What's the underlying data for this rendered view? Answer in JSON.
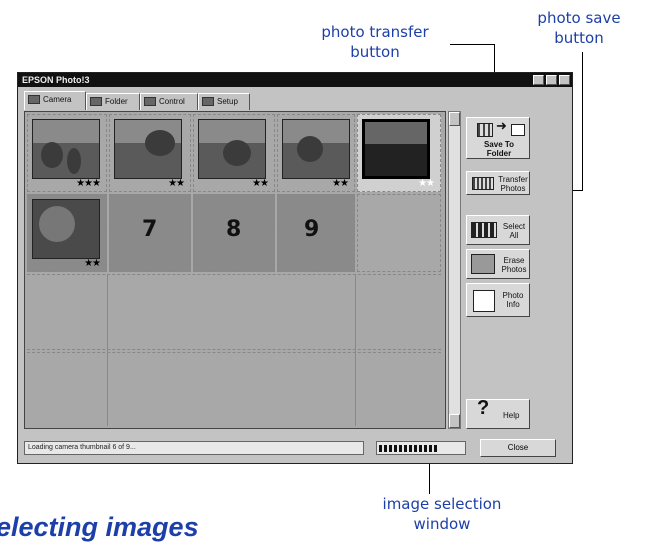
{
  "callouts": {
    "transfer": [
      "photo transfer",
      "button"
    ],
    "save": [
      "photo save",
      "button"
    ],
    "selection": [
      "image selection",
      "window"
    ]
  },
  "window": {
    "title": "EPSON Photo!3",
    "tabs": [
      "Camera",
      "Folder",
      "Control",
      "Setup"
    ]
  },
  "grid": {
    "thumbnails": [
      {
        "stars": "★★★"
      },
      {
        "stars": "★★"
      },
      {
        "stars": "★★"
      },
      {
        "stars": "★★"
      },
      {
        "stars": "★★",
        "selected": true
      },
      {
        "stars": "★★"
      }
    ],
    "placeholders": [
      "7",
      "8",
      "9"
    ]
  },
  "buttons": {
    "save_to_folder": "Save To Folder",
    "transfer_photos": "Transfer Photos",
    "select_all": "Select All",
    "erase_photos": "Erase Photos",
    "photo_info": "Photo Info",
    "help": "Help",
    "close": "Close"
  },
  "status": {
    "text": "Loading camera thumbnail 6 of 9...",
    "progress": 0.68
  },
  "section_heading": "electing images",
  "colors": {
    "accent": "#1d3fa8",
    "window_bg": "#c3c3c3"
  }
}
